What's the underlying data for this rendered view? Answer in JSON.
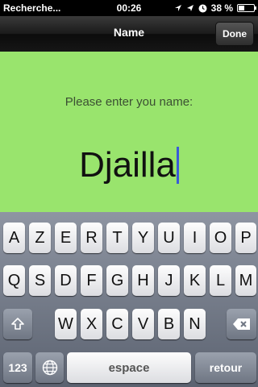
{
  "status_bar": {
    "carrier": "Recherche...",
    "time": "00:26",
    "battery_percent": "38 %",
    "battery_level": 0.38,
    "icons": [
      "signal-arrow-icon",
      "location-arrow-icon",
      "clock-icon",
      "battery-icon"
    ]
  },
  "nav_bar": {
    "title": "Name",
    "done_label": "Done"
  },
  "content": {
    "background_color": "#99e46d",
    "prompt": "Please enter you name:",
    "name_value": "Djailla"
  },
  "keyboard": {
    "row1": [
      "A",
      "Z",
      "E",
      "R",
      "T",
      "Y",
      "U",
      "I",
      "O",
      "P"
    ],
    "row2": [
      "Q",
      "S",
      "D",
      "F",
      "G",
      "H",
      "J",
      "K",
      "L",
      "M"
    ],
    "row3": [
      "W",
      "X",
      "C",
      "V",
      "B",
      "N"
    ],
    "shift_icon": "shift-icon",
    "backspace_icon": "backspace-icon",
    "numbers_label": "123",
    "globe_icon": "globe-icon",
    "space_label": "espace",
    "return_label": "retour"
  }
}
